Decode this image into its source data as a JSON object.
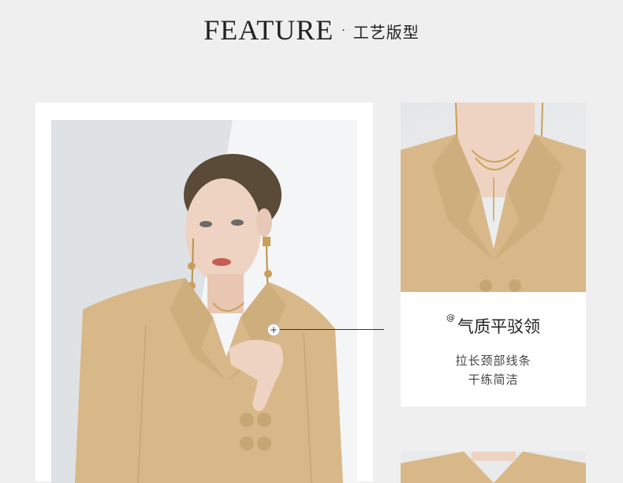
{
  "header": {
    "title": "FEATURE",
    "separator": "·",
    "subtitle": "工艺版型"
  },
  "feature": {
    "marker": "@",
    "title": "气质平驳领",
    "lines": [
      "拉长颈部线条",
      "干练简洁"
    ]
  },
  "callout": {
    "icon": "plus-icon",
    "symbol": "+"
  },
  "colors": {
    "background": "#efefef",
    "card": "#ffffff",
    "blazer": "#d9b98a",
    "text": "#222222"
  }
}
